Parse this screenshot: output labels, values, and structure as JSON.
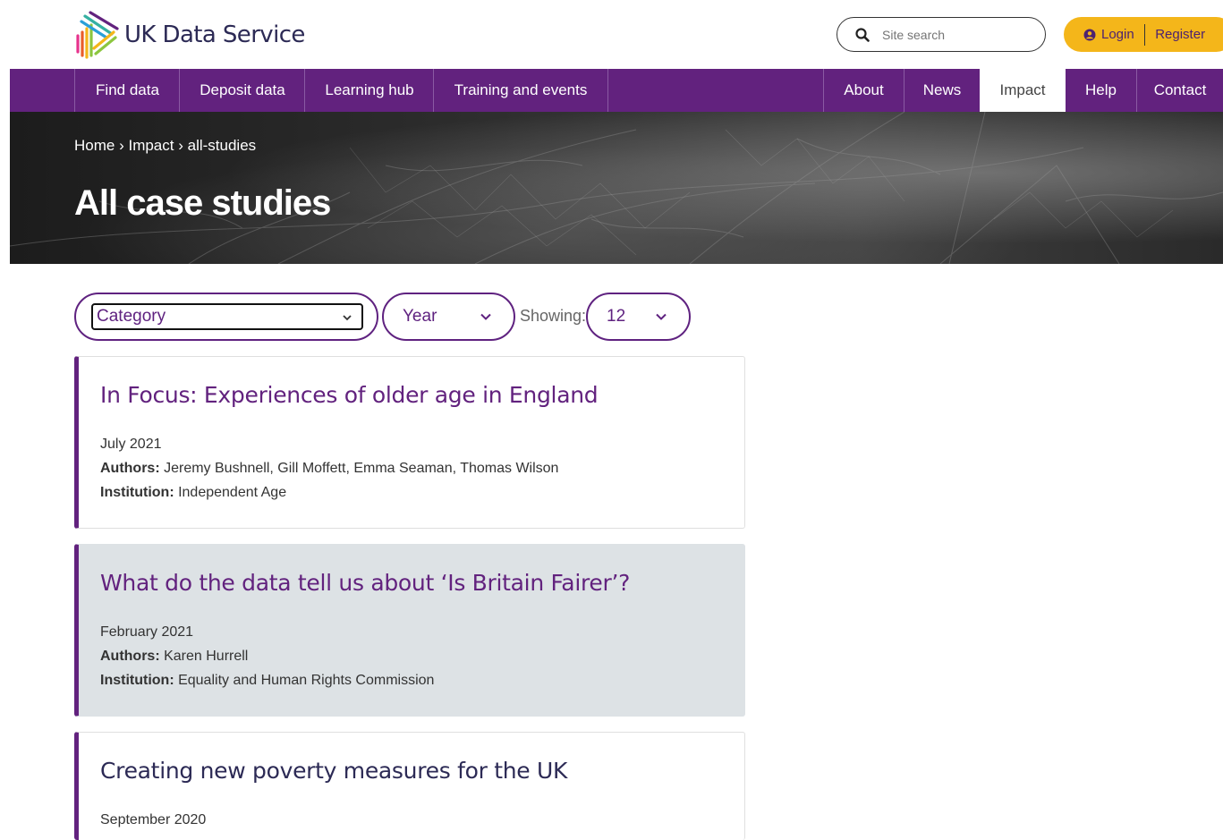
{
  "brand": {
    "name": "UK Data Service"
  },
  "search": {
    "placeholder": "Site search"
  },
  "account": {
    "login": "Login",
    "register": "Register"
  },
  "nav": {
    "left": [
      "Find data",
      "Deposit data",
      "Learning hub",
      "Training and events"
    ],
    "right": [
      "About",
      "News",
      "Impact",
      "Help",
      "Contact"
    ],
    "active": "Impact"
  },
  "breadcrumb": {
    "home": "Home",
    "sep": " › ",
    "impact": "Impact",
    "current": "all-studies"
  },
  "page": {
    "title": "All case studies"
  },
  "filters": {
    "category": "Category",
    "year": "Year",
    "showing_label": "Showing:",
    "showing_value": "12"
  },
  "cards": [
    {
      "title": "In Focus: Experiences of older age in England",
      "date": "July 2021",
      "authors_label": "Authors:",
      "authors": " Jeremy Bushnell, Gill Moffett, Emma Seaman, Thomas Wilson",
      "institution_label": "Institution:",
      "institution": " Independent Age"
    },
    {
      "title": "What do the data tell us about ‘Is Britain Fairer’?",
      "date": "February 2021",
      "authors_label": "Authors:",
      "authors": " Karen Hurrell",
      "institution_label": "Institution:",
      "institution": " Equality and Human Rights Commission"
    },
    {
      "title": "Creating new poverty measures for the UK",
      "date": "September 2020"
    }
  ],
  "colors": {
    "brand_purple": "#62227e",
    "accent_yellow": "#f4b61a",
    "navy": "#2c2a55",
    "card_alt": "#dde2e5"
  },
  "icons": {
    "search": "search-icon",
    "user": "user-circle-icon",
    "chevron": "chevron-down-icon"
  }
}
